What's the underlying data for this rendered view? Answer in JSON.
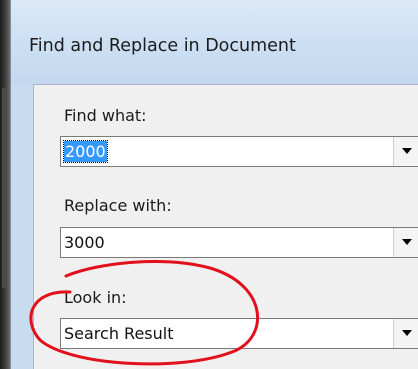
{
  "window": {
    "title": "Find and Replace in Document"
  },
  "find": {
    "label": "Find what:",
    "value": "2000"
  },
  "replace": {
    "label": "Replace with:",
    "value": "3000"
  },
  "look_in": {
    "label": "Look in:",
    "value": "Search Result"
  },
  "icons": {
    "dropdown": "chevron-down-icon"
  },
  "colors": {
    "title_bar": "#cde0f3",
    "dialog_body": "#f0f0f0",
    "selection": "#3399ff",
    "highlight_annotation": "#e0101c"
  }
}
